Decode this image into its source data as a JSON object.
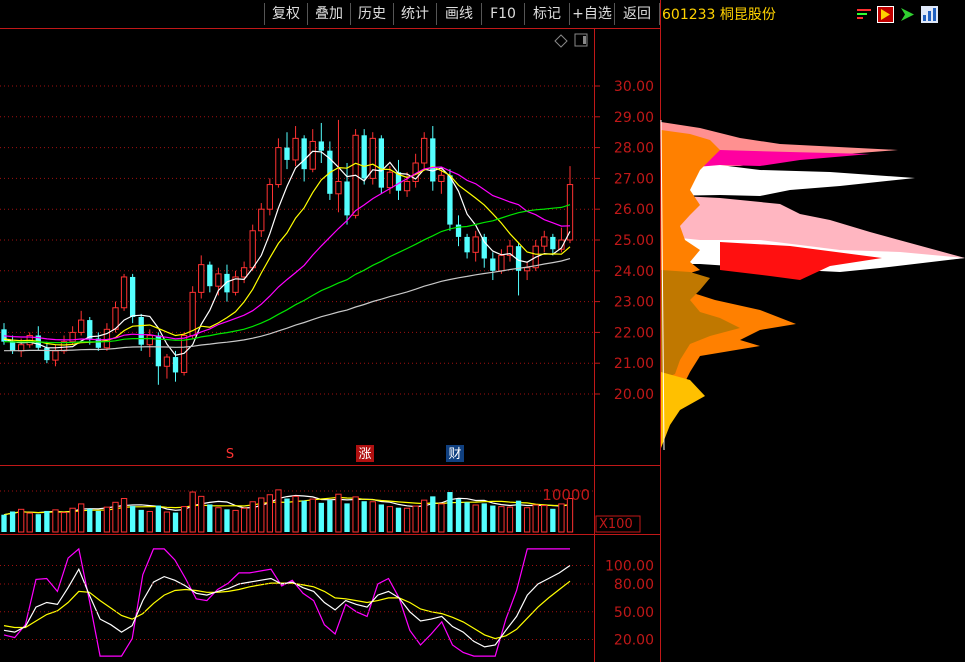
{
  "toolbar": {
    "buttons": [
      "复权",
      "叠加",
      "历史",
      "统计",
      "画线",
      "F10",
      "标记",
      "+自选",
      "返回"
    ],
    "stock_code": "601233",
    "stock_name": "桐昆股份"
  },
  "icons": [
    "bars-icon",
    "flag-icon",
    "arrow-icon",
    "chart-icon"
  ],
  "colors": {
    "up": "#ff3232",
    "down": "#54ffff",
    "ma5": "#ffffff",
    "ma10": "#ffff00",
    "ma20": "#ff00ff",
    "ma60": "#00e600",
    "ma120": "#c8c8c8",
    "axis": "#c01818"
  },
  "markers": [
    {
      "text": "S",
      "color": "#ff3232"
    },
    {
      "text": "涨",
      "color": "#ffffff",
      "bg": "#b01010"
    },
    {
      "text": "财",
      "color": "#ffffff",
      "bg": "#104080"
    }
  ],
  "chart_data": [
    {
      "type": "candlestick",
      "ylim": [
        18.9,
        31.0
      ],
      "price_ticks": [
        "30.00",
        "29.00",
        "28.00",
        "27.00",
        "26.00",
        "25.00",
        "24.00",
        "23.00",
        "22.00",
        "21.00",
        "20.00"
      ],
      "candles": [
        [
          22.1,
          22.3,
          21.7,
          21.6
        ],
        [
          21.7,
          21.9,
          21.4,
          21.3
        ],
        [
          21.4,
          21.8,
          21.6,
          21.2
        ],
        [
          21.6,
          22.0,
          21.9,
          21.5
        ],
        [
          21.9,
          22.2,
          21.5,
          21.4
        ],
        [
          21.5,
          21.7,
          21.1,
          21.0
        ],
        [
          21.1,
          21.6,
          21.4,
          20.9
        ],
        [
          21.4,
          21.9,
          21.7,
          21.3
        ],
        [
          21.7,
          22.2,
          22.0,
          21.6
        ],
        [
          22.0,
          22.7,
          22.4,
          21.9
        ],
        [
          22.4,
          22.5,
          21.8,
          21.6
        ],
        [
          21.8,
          22.0,
          21.5,
          21.4
        ],
        [
          21.5,
          22.3,
          22.1,
          21.4
        ],
        [
          22.1,
          23.0,
          22.8,
          22.0
        ],
        [
          22.8,
          23.9,
          23.8,
          22.7
        ],
        [
          23.8,
          23.9,
          22.5,
          22.3
        ],
        [
          22.5,
          22.6,
          21.6,
          21.4
        ],
        [
          21.6,
          22.1,
          21.9,
          21.2
        ],
        [
          21.9,
          22.0,
          20.9,
          20.3
        ],
        [
          20.9,
          21.3,
          21.2,
          20.5
        ],
        [
          21.2,
          21.4,
          20.7,
          20.4
        ],
        [
          20.7,
          22.0,
          21.9,
          20.6
        ],
        [
          21.9,
          23.5,
          23.3,
          21.8
        ],
        [
          23.3,
          24.5,
          24.2,
          23.1
        ],
        [
          24.2,
          24.3,
          23.5,
          23.3
        ],
        [
          23.5,
          24.1,
          23.9,
          23.2
        ],
        [
          23.9,
          24.2,
          23.3,
          23.0
        ],
        [
          23.3,
          24.0,
          23.8,
          23.2
        ],
        [
          23.8,
          24.3,
          24.1,
          23.6
        ],
        [
          24.1,
          25.5,
          25.3,
          24.0
        ],
        [
          25.3,
          26.2,
          26.0,
          25.1
        ],
        [
          26.0,
          27.0,
          26.8,
          25.8
        ],
        [
          26.8,
          28.3,
          28.0,
          26.7
        ],
        [
          28.0,
          28.5,
          27.6,
          27.3
        ],
        [
          27.6,
          28.7,
          28.3,
          27.4
        ],
        [
          28.3,
          28.4,
          27.3,
          26.9
        ],
        [
          27.3,
          28.6,
          28.2,
          27.2
        ],
        [
          28.2,
          28.8,
          27.9,
          27.5
        ],
        [
          27.9,
          28.2,
          26.5,
          26.3
        ],
        [
          26.5,
          28.9,
          26.9,
          25.9
        ],
        [
          26.9,
          27.5,
          25.8,
          25.5
        ],
        [
          25.8,
          28.6,
          28.4,
          25.7
        ],
        [
          28.4,
          28.6,
          27.0,
          26.8
        ],
        [
          27.0,
          28.5,
          28.3,
          26.8
        ],
        [
          28.3,
          28.4,
          26.7,
          26.5
        ],
        [
          26.7,
          27.4,
          27.2,
          26.5
        ],
        [
          27.2,
          27.6,
          26.6,
          26.3
        ],
        [
          26.6,
          27.2,
          26.9,
          26.4
        ],
        [
          26.9,
          27.8,
          27.5,
          26.7
        ],
        [
          27.5,
          28.5,
          28.3,
          27.3
        ],
        [
          28.3,
          28.7,
          26.9,
          26.6
        ],
        [
          26.9,
          27.3,
          27.1,
          26.5
        ],
        [
          27.1,
          27.3,
          25.5,
          25.3
        ],
        [
          25.5,
          25.8,
          25.1,
          24.8
        ],
        [
          25.1,
          25.2,
          24.6,
          24.4
        ],
        [
          24.6,
          25.3,
          25.1,
          24.3
        ],
        [
          25.1,
          25.2,
          24.4,
          24.1
        ],
        [
          24.4,
          24.6,
          24.0,
          23.7
        ],
        [
          24.0,
          24.7,
          24.5,
          23.9
        ],
        [
          24.5,
          25.0,
          24.8,
          24.3
        ],
        [
          24.8,
          24.9,
          24.0,
          23.2
        ],
        [
          24.0,
          24.3,
          24.1,
          23.7
        ],
        [
          24.1,
          25.0,
          24.8,
          24.0
        ],
        [
          24.8,
          25.3,
          25.1,
          24.6
        ],
        [
          25.1,
          25.2,
          24.7,
          24.5
        ],
        [
          24.7,
          25.4,
          25.0,
          24.6
        ],
        [
          25.0,
          27.4,
          26.8,
          24.9
        ]
      ],
      "volume": {
        "ylim": [
          0,
          16000
        ],
        "unit": "X100",
        "ticks": [
          "10000"
        ],
        "values": [
          3200,
          3800,
          4200,
          3500,
          3300,
          3900,
          4100,
          3600,
          4400,
          5200,
          4300,
          3900,
          4600,
          5500,
          6200,
          4800,
          4100,
          3800,
          4900,
          3700,
          3600,
          4700,
          7400,
          6600,
          5100,
          4500,
          4200,
          4000,
          4400,
          5600,
          6300,
          6900,
          7800,
          6200,
          6600,
          5800,
          6100,
          5400,
          5900,
          7000,
          5300,
          6500,
          5700,
          5600,
          5100,
          4700,
          4500,
          4400,
          4800,
          5900,
          6600,
          5200,
          7400,
          6100,
          5500,
          5000,
          5300,
          4900,
          4700,
          4600,
          5800,
          4500,
          5000,
          4900,
          4300,
          5200,
          6200
        ]
      },
      "oscillator": {
        "ylim": [
          0,
          120
        ],
        "ticks": [
          "100.00",
          "80.00",
          "50.00",
          "20.00"
        ],
        "k": [
          30,
          28,
          34,
          55,
          60,
          58,
          76,
          96,
          68,
          42,
          36,
          28,
          35,
          62,
          82,
          88,
          84,
          78,
          70,
          68,
          72,
          75,
          80,
          82,
          84,
          86,
          80,
          82,
          76,
          72,
          60,
          52,
          62,
          58,
          55,
          68,
          72,
          65,
          50,
          40,
          42,
          45,
          34,
          28,
          18,
          12,
          14,
          30,
          45,
          68,
          80,
          86,
          92,
          100
        ],
        "d": [
          35,
          33,
          33,
          40,
          47,
          51,
          60,
          72,
          71,
          62,
          54,
          46,
          42,
          48,
          59,
          68,
          73,
          74,
          73,
          71,
          71,
          72,
          74,
          77,
          79,
          81,
          81,
          81,
          79,
          77,
          72,
          65,
          64,
          62,
          60,
          62,
          65,
          65,
          60,
          53,
          50,
          48,
          44,
          39,
          32,
          25,
          21,
          24,
          31,
          43,
          55,
          65,
          74,
          83
        ],
        "j": [
          25,
          22,
          36,
          85,
          86,
          72,
          108,
          145,
          62,
          2,
          0,
          0,
          21,
          90,
          128,
          128,
          106,
          86,
          64,
          62,
          74,
          81,
          92,
          92,
          94,
          96,
          78,
          84,
          70,
          62,
          36,
          26,
          58,
          50,
          45,
          80,
          86,
          65,
          30,
          14,
          26,
          39,
          14,
          6,
          0,
          0,
          0,
          42,
          73,
          118,
          130,
          128,
          128,
          134
        ]
      }
    }
  ]
}
